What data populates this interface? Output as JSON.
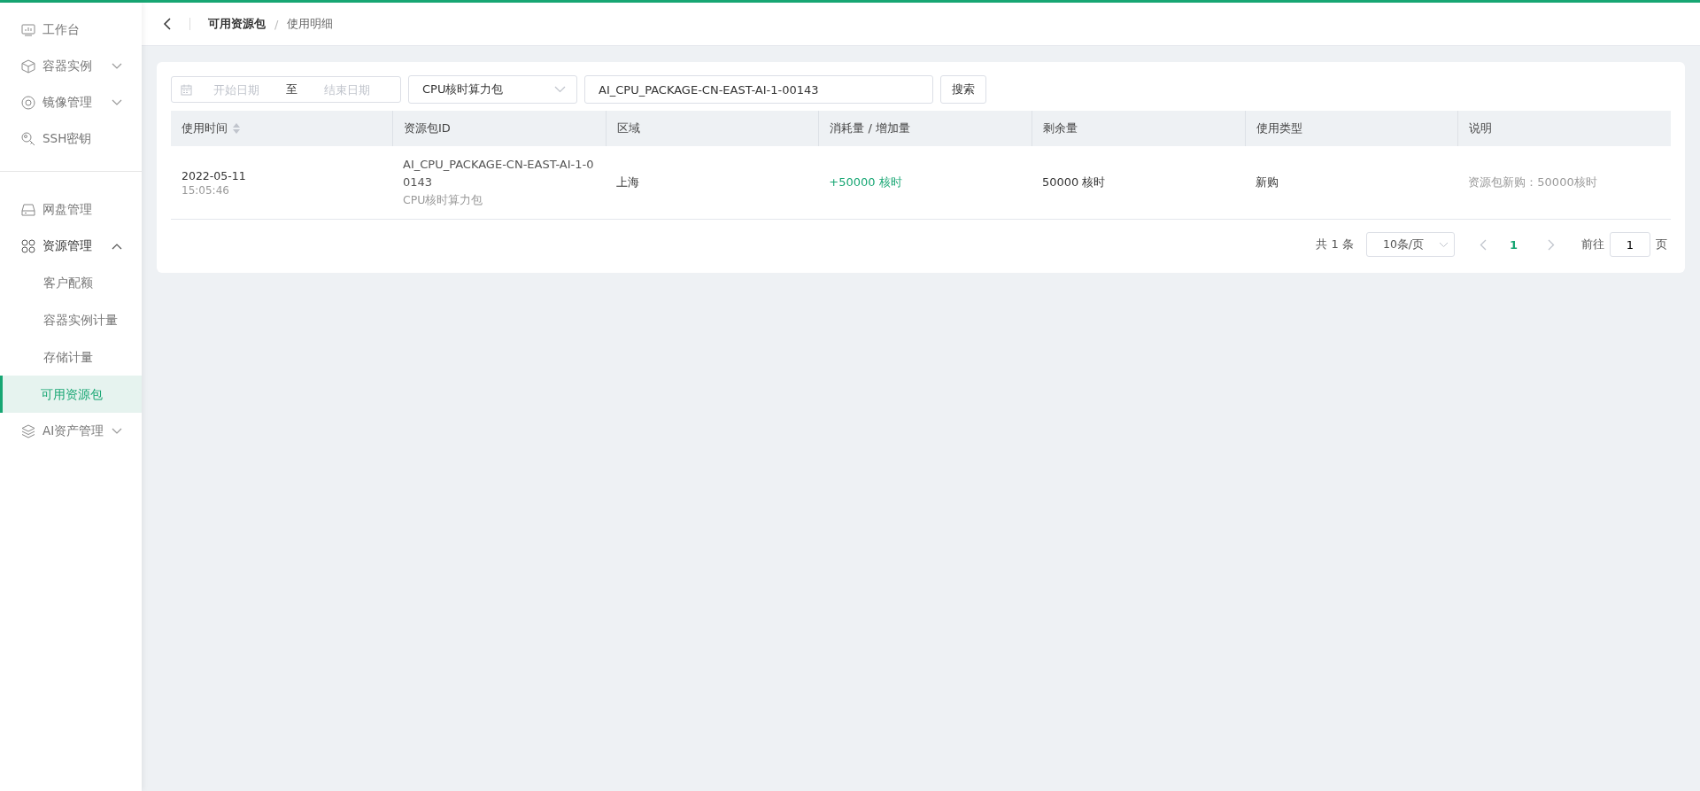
{
  "sidebar": {
    "sections": [
      {
        "items": [
          {
            "label": "工作台",
            "selected": false
          },
          {
            "label": "容器实例",
            "expanded": false,
            "selected": false
          },
          {
            "label": "镜像管理",
            "expanded": false,
            "selected": false
          },
          {
            "label": "SSH密钥",
            "selected": false
          }
        ]
      },
      {
        "items": [
          {
            "label": "网盘管理",
            "selected": false
          },
          {
            "label": "资源管理",
            "expanded": true,
            "selected": false,
            "children": [
              {
                "label": "客户配额",
                "selected": false
              },
              {
                "label": "容器实例计量",
                "selected": false
              },
              {
                "label": "存储计量",
                "selected": false
              },
              {
                "label": "可用资源包",
                "selected": true
              }
            ]
          },
          {
            "label": "AI资产管理",
            "expanded": false,
            "selected": false
          }
        ]
      }
    ]
  },
  "breadcrumb": {
    "items": [
      "可用资源包",
      "使用明细"
    ],
    "separator": "/"
  },
  "filters": {
    "start_date": {
      "placeholder": "开始日期"
    },
    "separator": "至",
    "end_date": {
      "placeholder": "结束日期"
    },
    "package_type": "CPU核时算力包",
    "package_id": "AI_CPU_PACKAGE-CN-EAST-AI-1-00143",
    "search_button": "搜索"
  },
  "table": {
    "columns": [
      {
        "label": "使用时间",
        "sortable": true
      },
      {
        "label": "资源包ID",
        "sortable": false
      },
      {
        "label": "区域",
        "sortable": false
      },
      {
        "label": "消耗量 / 增加量",
        "sortable": false
      },
      {
        "label": "剩余量",
        "sortable": false
      },
      {
        "label": "使用类型",
        "sortable": false
      },
      {
        "label": "说明",
        "sortable": false
      }
    ],
    "rows": [
      {
        "date": "2022-05-11",
        "time": "15:05:46",
        "package_id": "AI_CPU_PACKAGE-CN-EAST-AI-1-00143",
        "package_name": "CPU核时算力包",
        "region": "上海",
        "change": "+50000 核时",
        "remaining": "50000 核时",
        "usage_type": "新购",
        "description": "资源包新购：50000核时"
      }
    ]
  },
  "pagination": {
    "total": "共 1 条",
    "page_size": "10条/页",
    "pages": [
      {
        "label": "1",
        "selected": true
      }
    ],
    "goto_label": "前往",
    "goto_value": "1",
    "goto_suffix": "页"
  }
}
